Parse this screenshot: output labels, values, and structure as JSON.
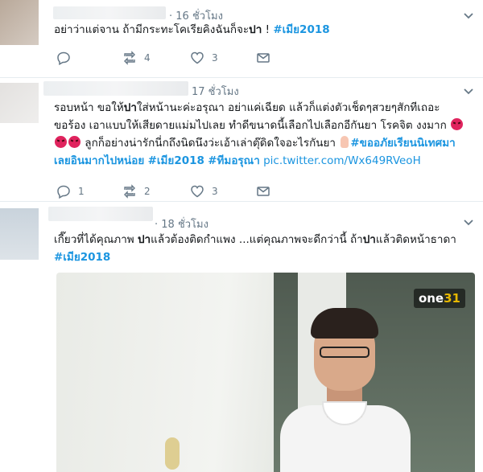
{
  "colors": {
    "hashtag": "#1b95e0",
    "meta_gray": "#657786",
    "divider": "#e6ecf0",
    "angry_emoji": "#e0245e"
  },
  "tweets": [
    {
      "time": "· 16 ชั่วโมง",
      "text_plain": "อย่าว่าแต่จาน ถ้ามีกระทะโคเรียคิงฉันก็จะ",
      "text_bold": "ปา",
      "text_after": " ! ",
      "hashtag": "#เมีย2018",
      "actions": {
        "reply_count": "",
        "retweet_count": "4",
        "like_count": "3"
      }
    },
    {
      "time": "17 ชั่วโมง",
      "line1_a": "รอบหน้า ขอให้",
      "line1_b": "ปา",
      "line1_c": "ใส่หน้านะค่ะอรุณา อย่าแค่เฉียด แล้วก็แต่งตัวเช็ดๆสวยๆสักทีเถอะ",
      "line2": "ขอร้อง เอาแบบให้เสียดายแม่มไปเลย ทำดีขนาดนี้เลือกไปเลือกอีกันยา โรคจิต งงมาก",
      "line3": " ลูกก็อย่างน่ารักนี่กถึงนิดนึงว่ะเอ้าเล่าตุ๊ดิดใจอะไรกันยา",
      "tag1": "#ขออภัยเรียนนิเทศมา",
      "line4_tag": "เลยอินมากไปหน่อย",
      "tag2": "#เมีย2018",
      "tag3": "#ทีมอรุณา",
      "link": "pic.twitter.com/Wx649RVeoH",
      "actions": {
        "reply_count": "1",
        "retweet_count": "2",
        "like_count": "3"
      }
    },
    {
      "time": "· 18 ชั่วโมง",
      "line1_a": "เกี๊ยวที่ได้คุณภาพ ",
      "line1_b": "ปา",
      "line1_c": "แล้วต้องติดกำแพง ...แต่คุณภาพจะดีกว่านี้ ถ้า",
      "line1_d": "ปา",
      "line1_e": "แล้วติดหน้าธาดา",
      "hashtag": "#เมีย2018",
      "media": {
        "channel_logo_text": "one",
        "channel_number": "31"
      }
    }
  ]
}
